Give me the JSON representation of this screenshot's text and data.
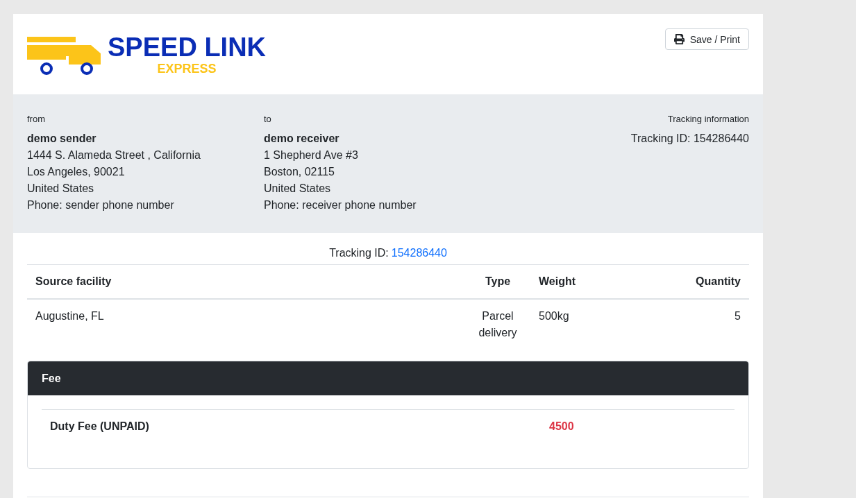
{
  "logo": {
    "title": "SPEED LINK",
    "subtitle": "EXPRESS"
  },
  "save_button": {
    "label": "Save / Print"
  },
  "from": {
    "label": "from",
    "name": "demo sender",
    "lines": [
      "1444 S. Alameda Street , California",
      "Los Angeles, 90021",
      "United States",
      "Phone: sender phone number"
    ]
  },
  "to": {
    "label": "to",
    "name": "demo receiver",
    "lines": [
      "1 Shepherd Ave #3",
      "Boston, 02115",
      "United States",
      "Phone: receiver phone number"
    ]
  },
  "tracking_info": {
    "label": "Tracking information",
    "text": "Tracking ID: 154286440"
  },
  "tracking": {
    "label": "Tracking ID:",
    "value": "154286440"
  },
  "table": {
    "columns": [
      "Source facility",
      "Type",
      "Weight",
      "Quantity"
    ],
    "rows": [
      [
        "Augustine, FL",
        "Parcel delivery",
        "500kg",
        "5"
      ]
    ]
  },
  "fee": {
    "title": "Fee",
    "items": [
      {
        "label": "Duty Fee (UNPAID)",
        "amount": "4500"
      }
    ]
  }
}
